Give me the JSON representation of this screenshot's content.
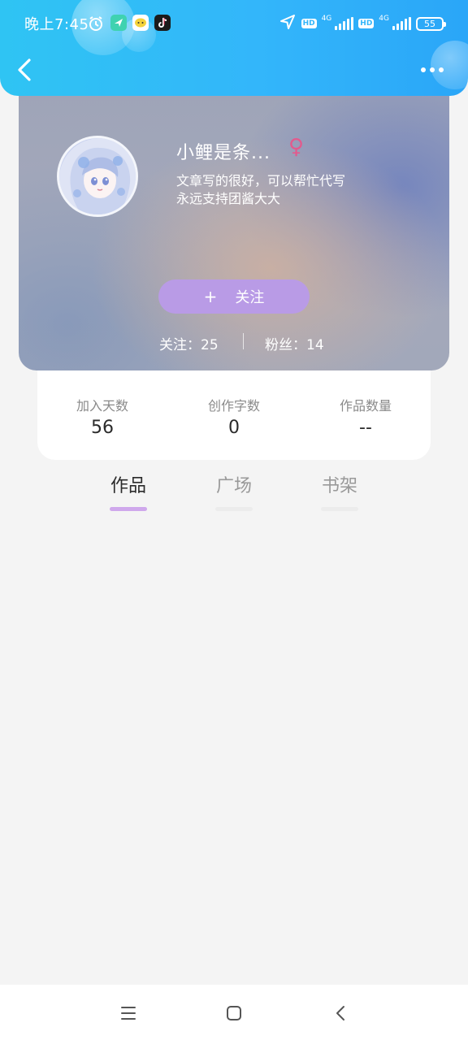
{
  "status_bar": {
    "time": "晚上7:45",
    "battery": "55",
    "network_label": "4G",
    "hd_label": "HD"
  },
  "header": {
    "back_icon": "chevron-left-icon",
    "more_icon": "more-dots-icon"
  },
  "profile": {
    "nickname": "小鲤是条...",
    "gender_symbol": "♀",
    "bio_line1": "文章写的很好，可以帮忙代写",
    "bio_line2": "永远支持团酱大大",
    "follow_plus": "+",
    "follow_label": "关注",
    "following": "关注：25",
    "fans": "粉丝：14"
  },
  "stats": [
    {
      "label": "加入天数",
      "value": "56"
    },
    {
      "label": "创作字数",
      "value": "0"
    },
    {
      "label": "作品数量",
      "value": "--"
    }
  ],
  "tabs": [
    {
      "label": "作品",
      "active": true
    },
    {
      "label": "广场",
      "active": false
    },
    {
      "label": "书架",
      "active": false
    }
  ],
  "nav": {
    "menu_icon": "menu-icon",
    "home_icon": "home-square-icon",
    "back_icon": "back-triangle-icon"
  },
  "colors": {
    "header_blue": "#33b6fa",
    "follow_purple": "#b99be6",
    "gender_pink": "#e35a8d",
    "tab_indicator": "#cfa8ec"
  }
}
